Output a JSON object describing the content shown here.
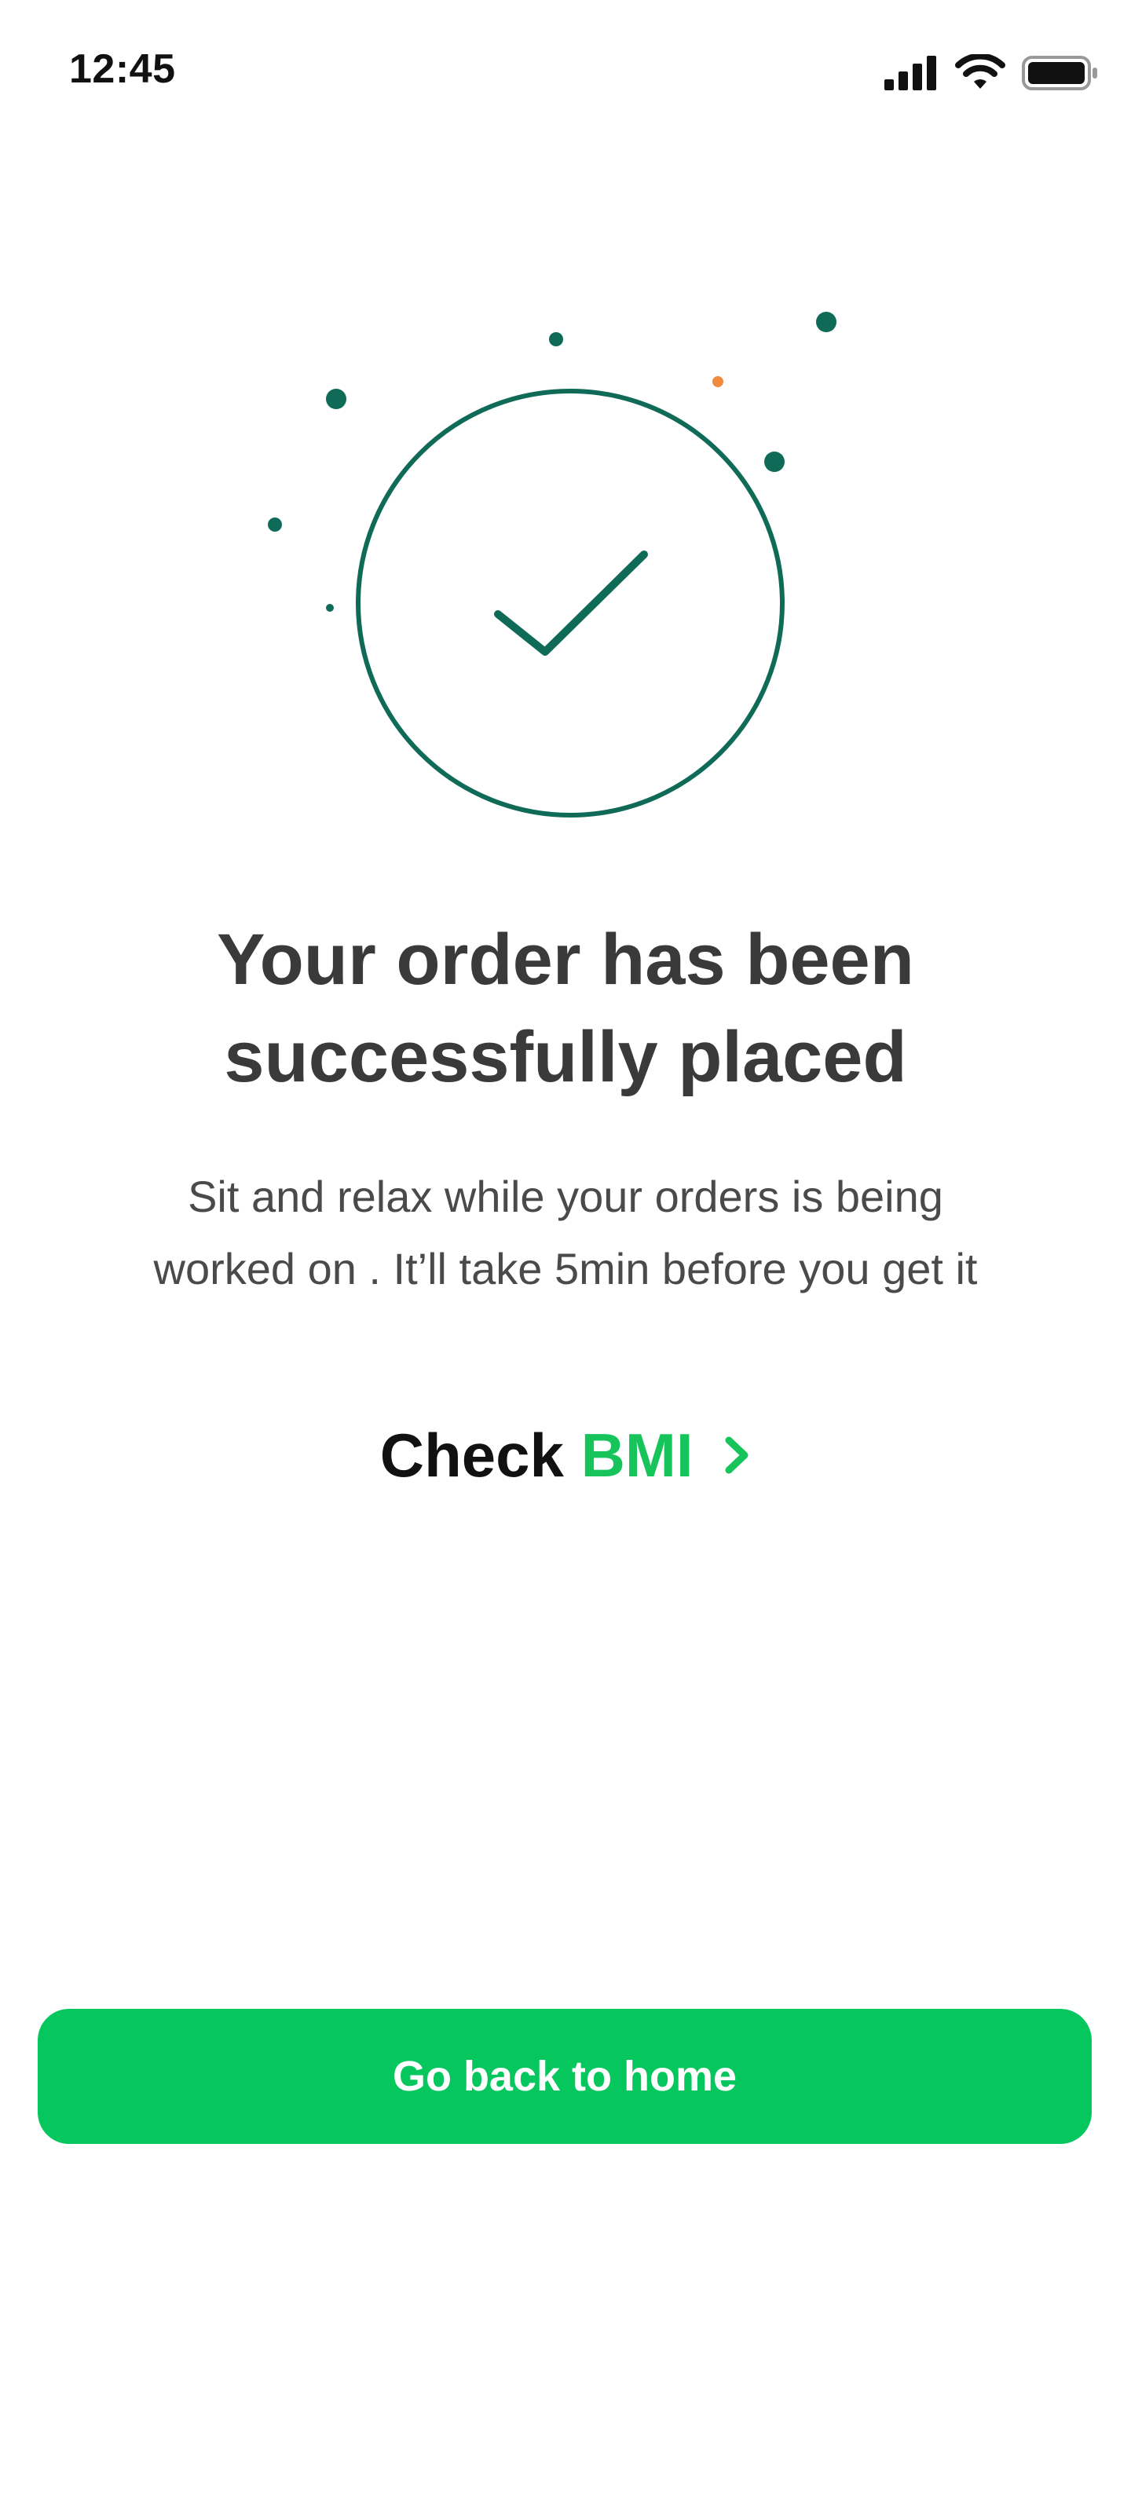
{
  "status_bar": {
    "time": "12:45",
    "icons": [
      "signal-icon",
      "wifi-icon",
      "battery-icon"
    ]
  },
  "illustration": {
    "icon": "check-circle-icon",
    "accent_color": "#0f6b57",
    "dot_accent_color": "#f08a3c"
  },
  "confirmation": {
    "title_line1": "Your order has been",
    "title_line2": "successfully placed",
    "subtitle_line1": "Sit and relax while your orders is being",
    "subtitle_line2": "worked on . It’ll take 5min before you get it"
  },
  "bmi_link": {
    "prefix": "Check",
    "highlight": "BMI",
    "highlight_color": "#17c45c",
    "icon": "chevron-right-icon"
  },
  "home_button": {
    "label": "Go back to home",
    "color": "#05c75d"
  }
}
